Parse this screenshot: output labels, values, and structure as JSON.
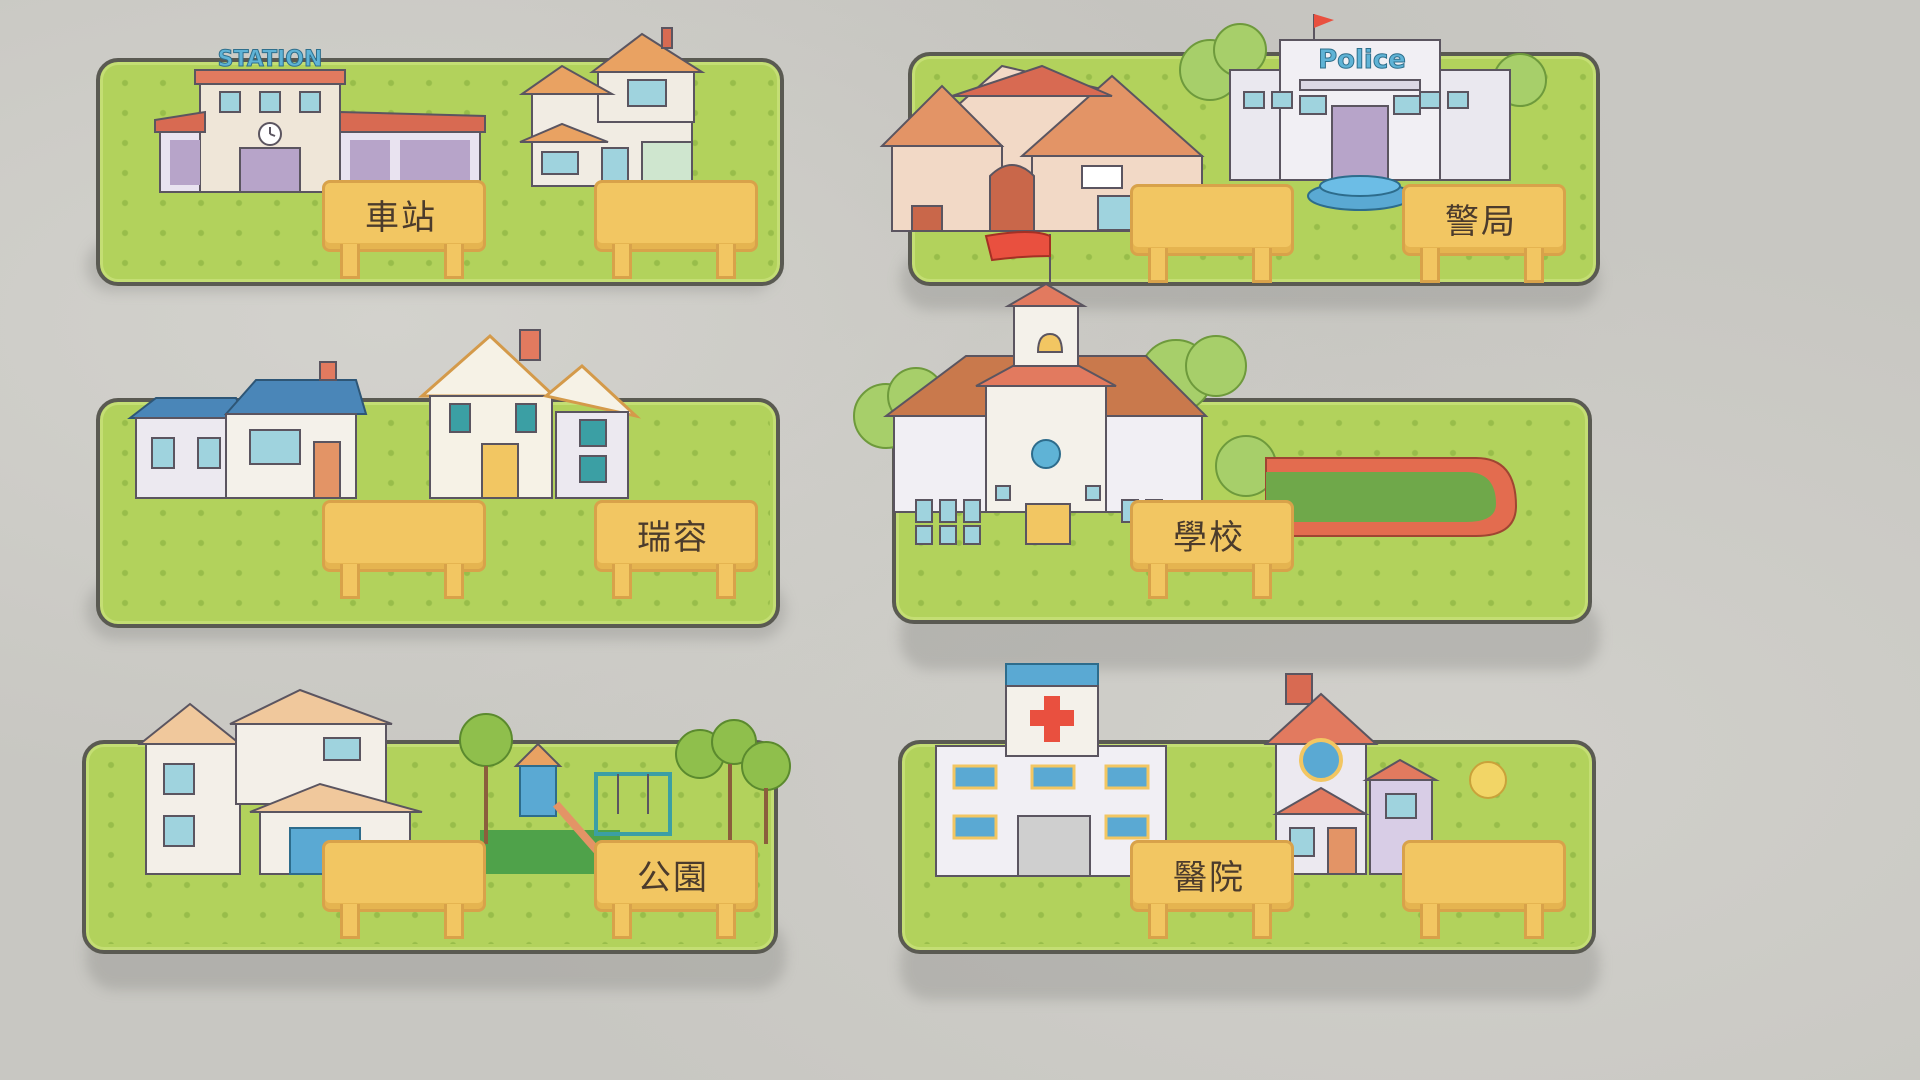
{
  "signs": {
    "station": "車站",
    "house_a": "",
    "house_b": "",
    "police": "警局",
    "house_c": "",
    "ruifang": "瑞容",
    "school": "學校",
    "house_d": "",
    "park": "公園",
    "hospital": "醫院",
    "house_e": ""
  },
  "building_text": {
    "station_sign": "STATION",
    "police_sign": "Police"
  },
  "colors": {
    "background": "#c8c7c2",
    "grass": "#b2d25c",
    "sign_board": "#f2c662",
    "sign_border": "#d8a24a",
    "roof_red": "#e27a5f",
    "roof_blue": "#4a86b8",
    "flag_red": "#e9503f",
    "track": "#e36c4f"
  },
  "icons": [
    "flag-icon",
    "bell-icon",
    "clock-icon",
    "red-cross-icon"
  ]
}
